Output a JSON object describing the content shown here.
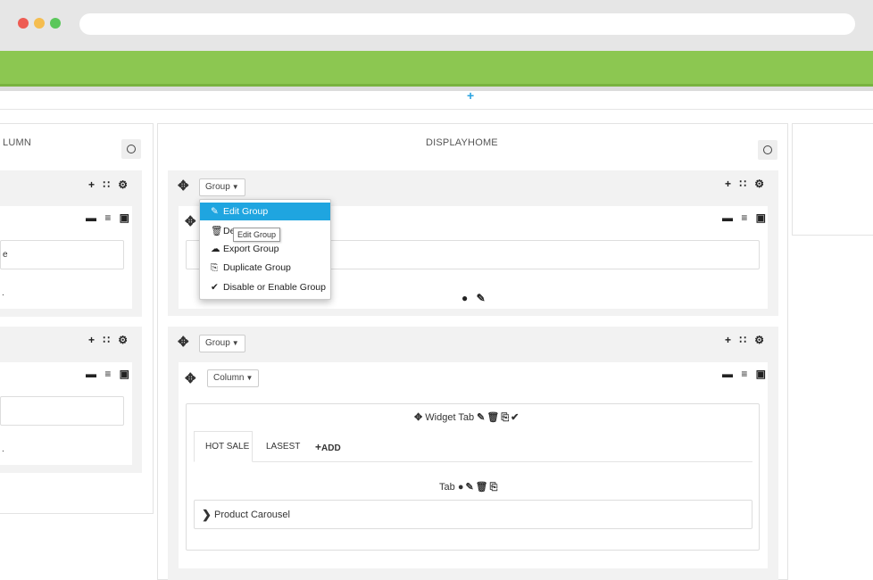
{
  "browser": {
    "dots": [
      "#ee5c53",
      "#f5bd4f",
      "#5bc75b"
    ]
  },
  "top_add_icon": "+",
  "left_column": {
    "title": "LUMN",
    "input_fragment": "e",
    "dot_fragment": "."
  },
  "center_column": {
    "title": "DISPLAYHOME",
    "group1": {
      "button_label": "Group",
      "dropdown": [
        {
          "icon": "✎",
          "label": "Edit Group",
          "active": true
        },
        {
          "icon": "🗑",
          "label": "De",
          "active": false
        },
        {
          "icon": "☁",
          "label": "Export Group",
          "active": false
        },
        {
          "icon": "⎘",
          "label": "Duplicate Group",
          "active": false
        },
        {
          "icon": "✔",
          "label": "Disable or Enable Group",
          "active": false
        }
      ],
      "tooltip": "Edit Group"
    },
    "group2": {
      "button_label": "Group",
      "column_button_label": "Column",
      "widget_tab_label": "Widget Tab",
      "tabs": [
        "HOT SALE",
        "LASEST"
      ],
      "add_label": "ADD",
      "tab_label": "Tab",
      "product_carousel_label": "Product Carousel"
    }
  },
  "toolbar_icons": {
    "group_actions": "+ ∷ ⚙",
    "column_actions": "− ≡ +"
  }
}
